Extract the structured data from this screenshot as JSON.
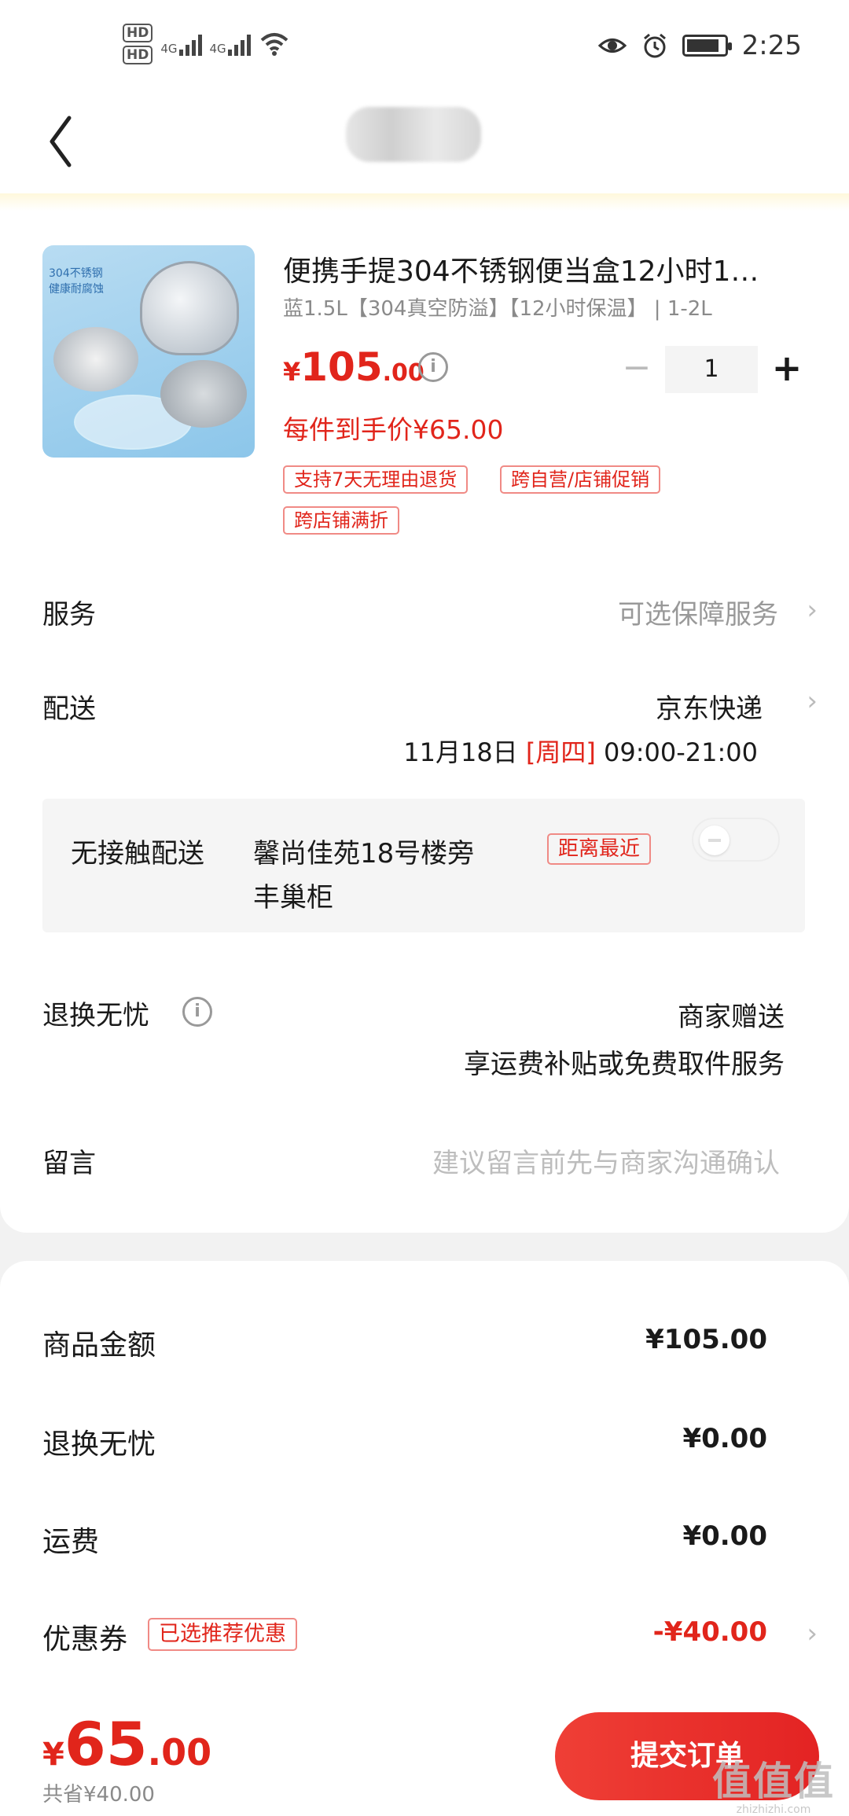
{
  "status_bar": {
    "hd1": "HD",
    "hd2": "HD",
    "net1": "4G",
    "net2": "4G",
    "time": "2:25"
  },
  "product": {
    "title": "便携手提304不锈钢便当盒12小时1…",
    "spec": "蓝1.5L【304真空防溢】【12小时保温】 | 1-2L",
    "thumb_line1": "304不锈钢",
    "thumb_line2": "健康耐腐蚀",
    "price_currency": "¥",
    "price_int": "105",
    "price_dec": ".00",
    "quantity": "1",
    "hand_price": "每件到手价¥65.00",
    "tags": [
      "支持7天无理由退货",
      "跨自营/店铺促销",
      "跨店铺满折"
    ]
  },
  "service": {
    "label": "服务",
    "value": "可选保障服务"
  },
  "delivery": {
    "label": "配送",
    "carrier": "京东快递",
    "date": "11月18日",
    "weekday": "[周四]",
    "time_range": "09:00-21:00"
  },
  "contactless": {
    "label": "无接触配送",
    "address_line1": "馨尚佳苑18号楼旁",
    "address_line2": "丰巢柜",
    "badge": "距离最近"
  },
  "return_worry_free": {
    "label": "退换无忧",
    "value_line1": "商家赠送",
    "value_line2": "享运费补贴或免费取件服务"
  },
  "note": {
    "label": "留言",
    "placeholder": "建议留言前先与商家沟通确认"
  },
  "summary": {
    "goods_label": "商品金额",
    "goods_value": "¥105.00",
    "return_label": "退换无忧",
    "return_value": "¥0.00",
    "shipping_label": "运费",
    "shipping_value": "¥0.00",
    "coupon_label": "优惠券",
    "coupon_badge": "已选推荐优惠",
    "coupon_value": "-¥40.00"
  },
  "bottom": {
    "currency": "¥",
    "total_int": "65",
    "total_dec": ".00",
    "saved": "共省¥40.00",
    "submit_label": "提交订单"
  },
  "watermark": {
    "big": "值值值",
    "small": "zhizhizhi.com"
  },
  "colors": {
    "accent": "#e1251b",
    "grey_text": "#8a8a8a",
    "page_bg": "#f2f2f2"
  }
}
